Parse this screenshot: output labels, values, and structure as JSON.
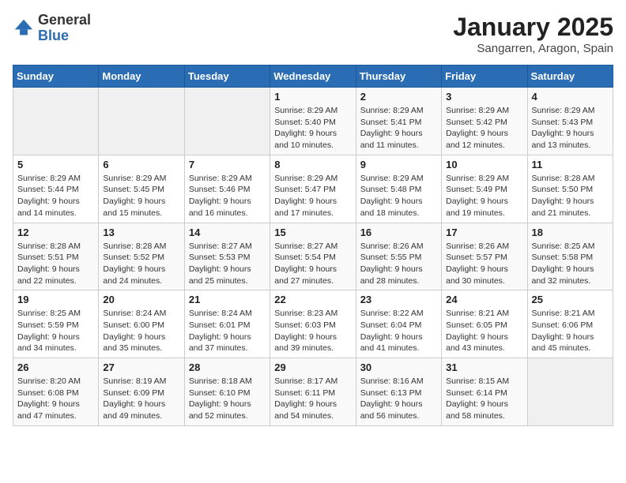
{
  "header": {
    "logo_general": "General",
    "logo_blue": "Blue",
    "month_title": "January 2025",
    "location": "Sangarren, Aragon, Spain"
  },
  "weekdays": [
    "Sunday",
    "Monday",
    "Tuesday",
    "Wednesday",
    "Thursday",
    "Friday",
    "Saturday"
  ],
  "weeks": [
    [
      {
        "day": "",
        "info": ""
      },
      {
        "day": "",
        "info": ""
      },
      {
        "day": "",
        "info": ""
      },
      {
        "day": "1",
        "info": "Sunrise: 8:29 AM\nSunset: 5:40 PM\nDaylight: 9 hours and 10 minutes."
      },
      {
        "day": "2",
        "info": "Sunrise: 8:29 AM\nSunset: 5:41 PM\nDaylight: 9 hours and 11 minutes."
      },
      {
        "day": "3",
        "info": "Sunrise: 8:29 AM\nSunset: 5:42 PM\nDaylight: 9 hours and 12 minutes."
      },
      {
        "day": "4",
        "info": "Sunrise: 8:29 AM\nSunset: 5:43 PM\nDaylight: 9 hours and 13 minutes."
      }
    ],
    [
      {
        "day": "5",
        "info": "Sunrise: 8:29 AM\nSunset: 5:44 PM\nDaylight: 9 hours and 14 minutes."
      },
      {
        "day": "6",
        "info": "Sunrise: 8:29 AM\nSunset: 5:45 PM\nDaylight: 9 hours and 15 minutes."
      },
      {
        "day": "7",
        "info": "Sunrise: 8:29 AM\nSunset: 5:46 PM\nDaylight: 9 hours and 16 minutes."
      },
      {
        "day": "8",
        "info": "Sunrise: 8:29 AM\nSunset: 5:47 PM\nDaylight: 9 hours and 17 minutes."
      },
      {
        "day": "9",
        "info": "Sunrise: 8:29 AM\nSunset: 5:48 PM\nDaylight: 9 hours and 18 minutes."
      },
      {
        "day": "10",
        "info": "Sunrise: 8:29 AM\nSunset: 5:49 PM\nDaylight: 9 hours and 19 minutes."
      },
      {
        "day": "11",
        "info": "Sunrise: 8:28 AM\nSunset: 5:50 PM\nDaylight: 9 hours and 21 minutes."
      }
    ],
    [
      {
        "day": "12",
        "info": "Sunrise: 8:28 AM\nSunset: 5:51 PM\nDaylight: 9 hours and 22 minutes."
      },
      {
        "day": "13",
        "info": "Sunrise: 8:28 AM\nSunset: 5:52 PM\nDaylight: 9 hours and 24 minutes."
      },
      {
        "day": "14",
        "info": "Sunrise: 8:27 AM\nSunset: 5:53 PM\nDaylight: 9 hours and 25 minutes."
      },
      {
        "day": "15",
        "info": "Sunrise: 8:27 AM\nSunset: 5:54 PM\nDaylight: 9 hours and 27 minutes."
      },
      {
        "day": "16",
        "info": "Sunrise: 8:26 AM\nSunset: 5:55 PM\nDaylight: 9 hours and 28 minutes."
      },
      {
        "day": "17",
        "info": "Sunrise: 8:26 AM\nSunset: 5:57 PM\nDaylight: 9 hours and 30 minutes."
      },
      {
        "day": "18",
        "info": "Sunrise: 8:25 AM\nSunset: 5:58 PM\nDaylight: 9 hours and 32 minutes."
      }
    ],
    [
      {
        "day": "19",
        "info": "Sunrise: 8:25 AM\nSunset: 5:59 PM\nDaylight: 9 hours and 34 minutes."
      },
      {
        "day": "20",
        "info": "Sunrise: 8:24 AM\nSunset: 6:00 PM\nDaylight: 9 hours and 35 minutes."
      },
      {
        "day": "21",
        "info": "Sunrise: 8:24 AM\nSunset: 6:01 PM\nDaylight: 9 hours and 37 minutes."
      },
      {
        "day": "22",
        "info": "Sunrise: 8:23 AM\nSunset: 6:03 PM\nDaylight: 9 hours and 39 minutes."
      },
      {
        "day": "23",
        "info": "Sunrise: 8:22 AM\nSunset: 6:04 PM\nDaylight: 9 hours and 41 minutes."
      },
      {
        "day": "24",
        "info": "Sunrise: 8:21 AM\nSunset: 6:05 PM\nDaylight: 9 hours and 43 minutes."
      },
      {
        "day": "25",
        "info": "Sunrise: 8:21 AM\nSunset: 6:06 PM\nDaylight: 9 hours and 45 minutes."
      }
    ],
    [
      {
        "day": "26",
        "info": "Sunrise: 8:20 AM\nSunset: 6:08 PM\nDaylight: 9 hours and 47 minutes."
      },
      {
        "day": "27",
        "info": "Sunrise: 8:19 AM\nSunset: 6:09 PM\nDaylight: 9 hours and 49 minutes."
      },
      {
        "day": "28",
        "info": "Sunrise: 8:18 AM\nSunset: 6:10 PM\nDaylight: 9 hours and 52 minutes."
      },
      {
        "day": "29",
        "info": "Sunrise: 8:17 AM\nSunset: 6:11 PM\nDaylight: 9 hours and 54 minutes."
      },
      {
        "day": "30",
        "info": "Sunrise: 8:16 AM\nSunset: 6:13 PM\nDaylight: 9 hours and 56 minutes."
      },
      {
        "day": "31",
        "info": "Sunrise: 8:15 AM\nSunset: 6:14 PM\nDaylight: 9 hours and 58 minutes."
      },
      {
        "day": "",
        "info": ""
      }
    ]
  ]
}
